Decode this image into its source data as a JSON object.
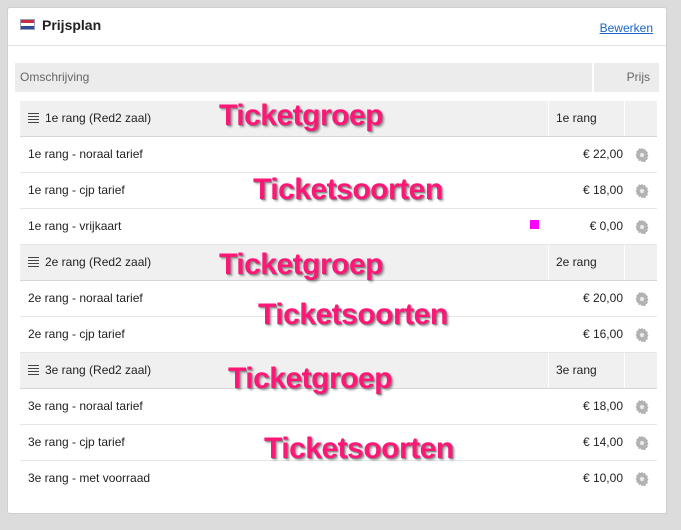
{
  "panel": {
    "title": "Prijsplan",
    "edit_link": "Bewerken"
  },
  "table": {
    "columns": {
      "description": "Omschrijving",
      "price": "Prijs"
    },
    "groups": [
      {
        "name": "1e rang (Red2 zaal)",
        "code": "1e rang",
        "types": [
          {
            "name": "1e rang - noraal tarief",
            "price": "€ 22,00"
          },
          {
            "name": "1e rang - cjp tarief",
            "price": "€ 18,00"
          },
          {
            "name": "1e rang - vrijkaart",
            "price": "€ 0,00"
          }
        ]
      },
      {
        "name": "2e rang (Red2 zaal)",
        "code": "2e rang",
        "types": [
          {
            "name": "2e rang - noraal tarief",
            "price": "€ 20,00"
          },
          {
            "name": "2e rang - cjp tarief",
            "price": "€ 16,00"
          }
        ]
      },
      {
        "name": "3e rang (Red2 zaal)",
        "code": "3e rang",
        "types": [
          {
            "name": "3e rang - noraal tarief",
            "price": "€ 18,00"
          },
          {
            "name": "3e rang - cjp tarief",
            "price": "€ 14,00"
          },
          {
            "name": "3e rang - met voorraad",
            "price": "€ 10,00"
          }
        ]
      }
    ]
  },
  "annotations": [
    "Ticketgroep",
    "Ticketsoorten",
    "Ticketgroep",
    "Ticketsoorten",
    "Ticketgroep",
    "Ticketsoorten"
  ],
  "colors": {
    "annotation": "#ff1777",
    "link": "#1a66c9",
    "marker": "#ff00ff"
  }
}
